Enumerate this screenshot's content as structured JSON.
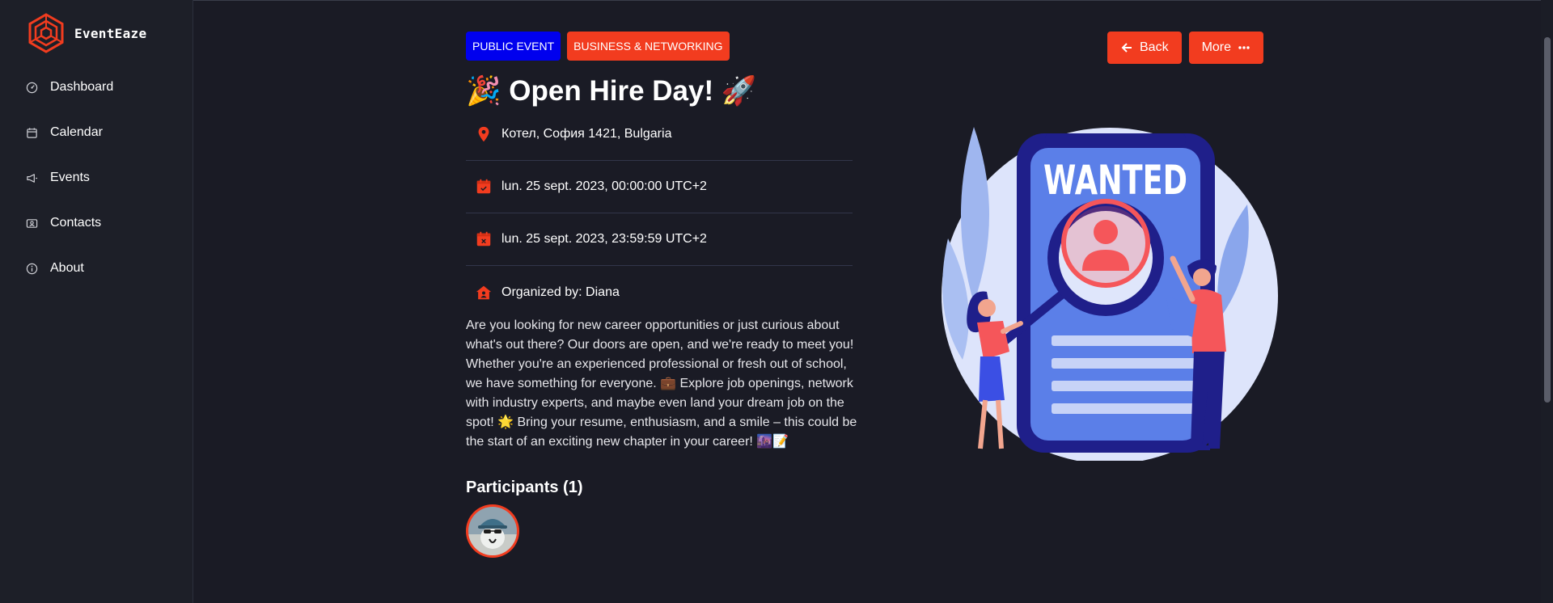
{
  "app": {
    "name": "EventEaze"
  },
  "sidebar": {
    "items": [
      {
        "label": "Dashboard",
        "icon": "dashboard-icon"
      },
      {
        "label": "Calendar",
        "icon": "calendar-icon"
      },
      {
        "label": "Events",
        "icon": "megaphone-icon"
      },
      {
        "label": "Contacts",
        "icon": "contacts-icon"
      },
      {
        "label": "About",
        "icon": "info-icon"
      }
    ]
  },
  "event": {
    "badges": {
      "visibility": "PUBLIC EVENT",
      "category": "BUSINESS & NETWORKING"
    },
    "title": "🎉 Open Hire Day! 🚀",
    "location": "Котел, София 1421, Bulgaria",
    "start": "lun. 25 sept. 2023, 00:00:00 UTC+2",
    "end": "lun. 25 sept. 2023, 23:59:59 UTC+2",
    "organizer": "Organized by: Diana",
    "description": "Are you looking for new career opportunities or just curious about what's out there? Our doors are open, and we're ready to meet you! Whether you're an experienced professional or fresh out of school, we have something for everyone. 💼 Explore job openings, network with industry experts, and maybe even land your dream job on the spot! 🌟 Bring your resume, enthusiasm, and a smile – this could be the start of an exciting new chapter in your career! 🌆📝",
    "participants_title": "Participants (1)",
    "illustration_text": "WANTED"
  },
  "actions": {
    "back_label": "Back",
    "more_label": "More"
  },
  "colors": {
    "background": "#1a1b25",
    "sidebar": "#1d1f28",
    "accent": "#f23c1f",
    "public_badge": "#0000ee"
  }
}
